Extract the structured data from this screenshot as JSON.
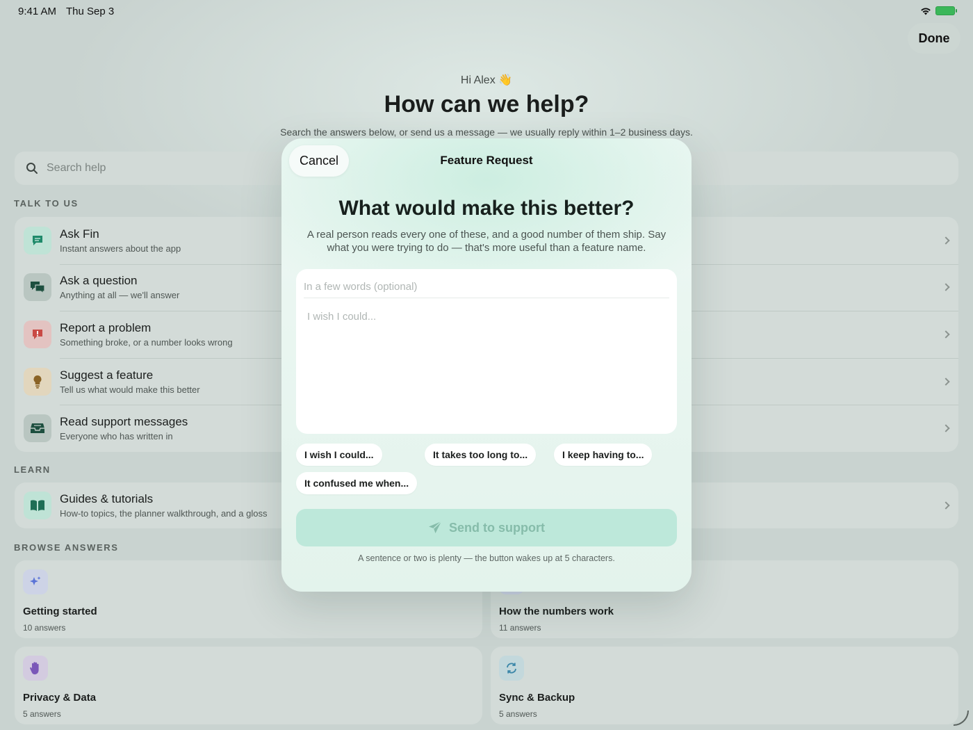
{
  "status_bar": {
    "time": "9:41 AM",
    "date": "Thu Sep 3"
  },
  "header": {
    "done_label": "Done"
  },
  "hero": {
    "greeting": "Hi Alex 👋",
    "title": "How can we help?",
    "subtitle": "Search the answers below, or send us a message — we usually reply within 1–2 business days."
  },
  "search": {
    "placeholder": "Search help"
  },
  "talk": {
    "label": "TALK TO US",
    "items": [
      {
        "title": "Ask Fin",
        "subtitle": "Instant answers about the app",
        "icon": "chat-bubble-icon"
      },
      {
        "title": "Ask a question",
        "subtitle": "Anything at all — we'll answer",
        "icon": "conversation-icon"
      },
      {
        "title": "Report a problem",
        "subtitle": "Something broke, or a number looks wrong",
        "icon": "exclamation-bubble-icon"
      },
      {
        "title": "Suggest a feature",
        "subtitle": "Tell us what would make this better",
        "icon": "lightbulb-icon"
      },
      {
        "title": "Read support messages",
        "subtitle": "Everyone who has written in",
        "icon": "tray-icon"
      }
    ]
  },
  "learn": {
    "label": "LEARN",
    "items": [
      {
        "title": "Guides & tutorials",
        "subtitle": "How-to topics, the planner walkthrough, and a gloss",
        "icon": "book-icon"
      }
    ]
  },
  "browse": {
    "label": "BROWSE ANSWERS",
    "tiles": [
      {
        "title": "Getting started",
        "count": "10 answers",
        "icon": "sparkles-icon"
      },
      {
        "title": "How the numbers work",
        "count": "11 answers",
        "icon": "chart-icon"
      },
      {
        "title": "Privacy & Data",
        "count": "5 answers",
        "icon": "hand-icon"
      },
      {
        "title": "Sync & Backup",
        "count": "5 answers",
        "icon": "sync-icon"
      }
    ]
  },
  "modal": {
    "cancel_label": "Cancel",
    "title": "Feature Request",
    "heading": "What would make this better?",
    "description": "A real person reads every one of these, and a good number of them ship. Say what you were trying to do — that's more useful than a feature name.",
    "summary_placeholder": "In a few words (optional)",
    "body_placeholder": "I wish I could...",
    "chips": [
      "I wish I could...",
      "It takes too long to...",
      "I keep having to...",
      "It confused me when..."
    ],
    "send_label": "Send to support",
    "hint": "A sentence or two is plenty — the button wakes up at 5 characters."
  },
  "colors": {
    "accent": "#1f8a6a",
    "send_disabled_bg": "#bde8da",
    "send_disabled_text": "#86bcaa"
  }
}
